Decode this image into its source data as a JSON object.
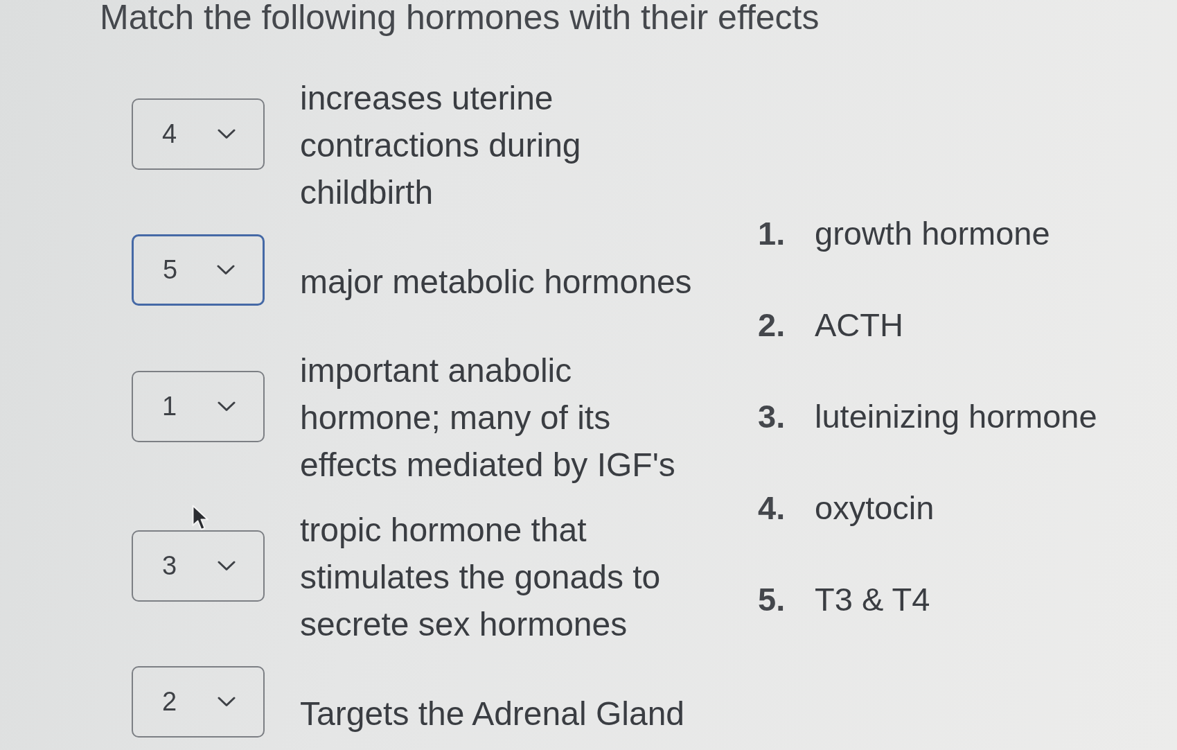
{
  "title": "Match the following hormones with their effects",
  "matches": [
    {
      "value": "4",
      "focused": false,
      "description": "increases uterine contractions during childbirth"
    },
    {
      "value": "5",
      "focused": true,
      "description": "major metabolic hormones"
    },
    {
      "value": "1",
      "focused": false,
      "description": "important anabolic hormone; many of its effects mediated by IGF's"
    },
    {
      "value": "3",
      "focused": false,
      "description": "tropic hormone that stimulates the gonads to secrete sex hormones"
    },
    {
      "value": "2",
      "focused": false,
      "description": "Targets the Adrenal Gland"
    }
  ],
  "options": [
    {
      "number": "1.",
      "name": "growth hormone"
    },
    {
      "number": "2.",
      "name": "ACTH"
    },
    {
      "number": "3.",
      "name": "luteinizing hormone"
    },
    {
      "number": "4.",
      "name": "oxytocin"
    },
    {
      "number": "5.",
      "name": "T3 & T4"
    }
  ]
}
